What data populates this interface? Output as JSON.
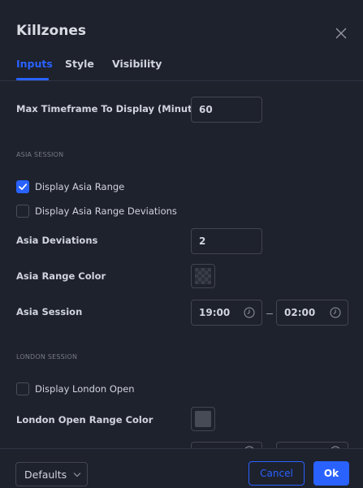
{
  "dialog": {
    "title": "Killzones"
  },
  "tabs": [
    {
      "label": "Inputs",
      "active": true
    },
    {
      "label": "Style",
      "active": false
    },
    {
      "label": "Visibility",
      "active": false
    }
  ],
  "fields": {
    "max_timeframe": {
      "label": "Max Timeframe To Display (Minutes)",
      "value": "60"
    },
    "asia_section": "ASIA SESSION",
    "display_asia_range": {
      "label": "Display Asia Range",
      "checked": true
    },
    "display_asia_range_deviations": {
      "label": "Display Asia Range Deviations",
      "checked": false
    },
    "asia_deviations": {
      "label": "Asia Deviations",
      "value": "2"
    },
    "asia_range_color": {
      "label": "Asia Range Color"
    },
    "asia_session": {
      "label": "Asia Session",
      "start": "19:00",
      "end": "02:00"
    },
    "london_section": "LONDON SESSION",
    "display_london_open": {
      "label": "Display London Open",
      "checked": false
    },
    "london_open_range_color": {
      "label": "London Open Range Color"
    }
  },
  "footer": {
    "defaults_label": "Defaults",
    "cancel_label": "Cancel",
    "ok_label": "Ok"
  },
  "colors": {
    "accent": "#2962ff",
    "background": "#1e222d",
    "border": "#434651",
    "text": "#d1d4dc",
    "muted": "#787b86"
  }
}
